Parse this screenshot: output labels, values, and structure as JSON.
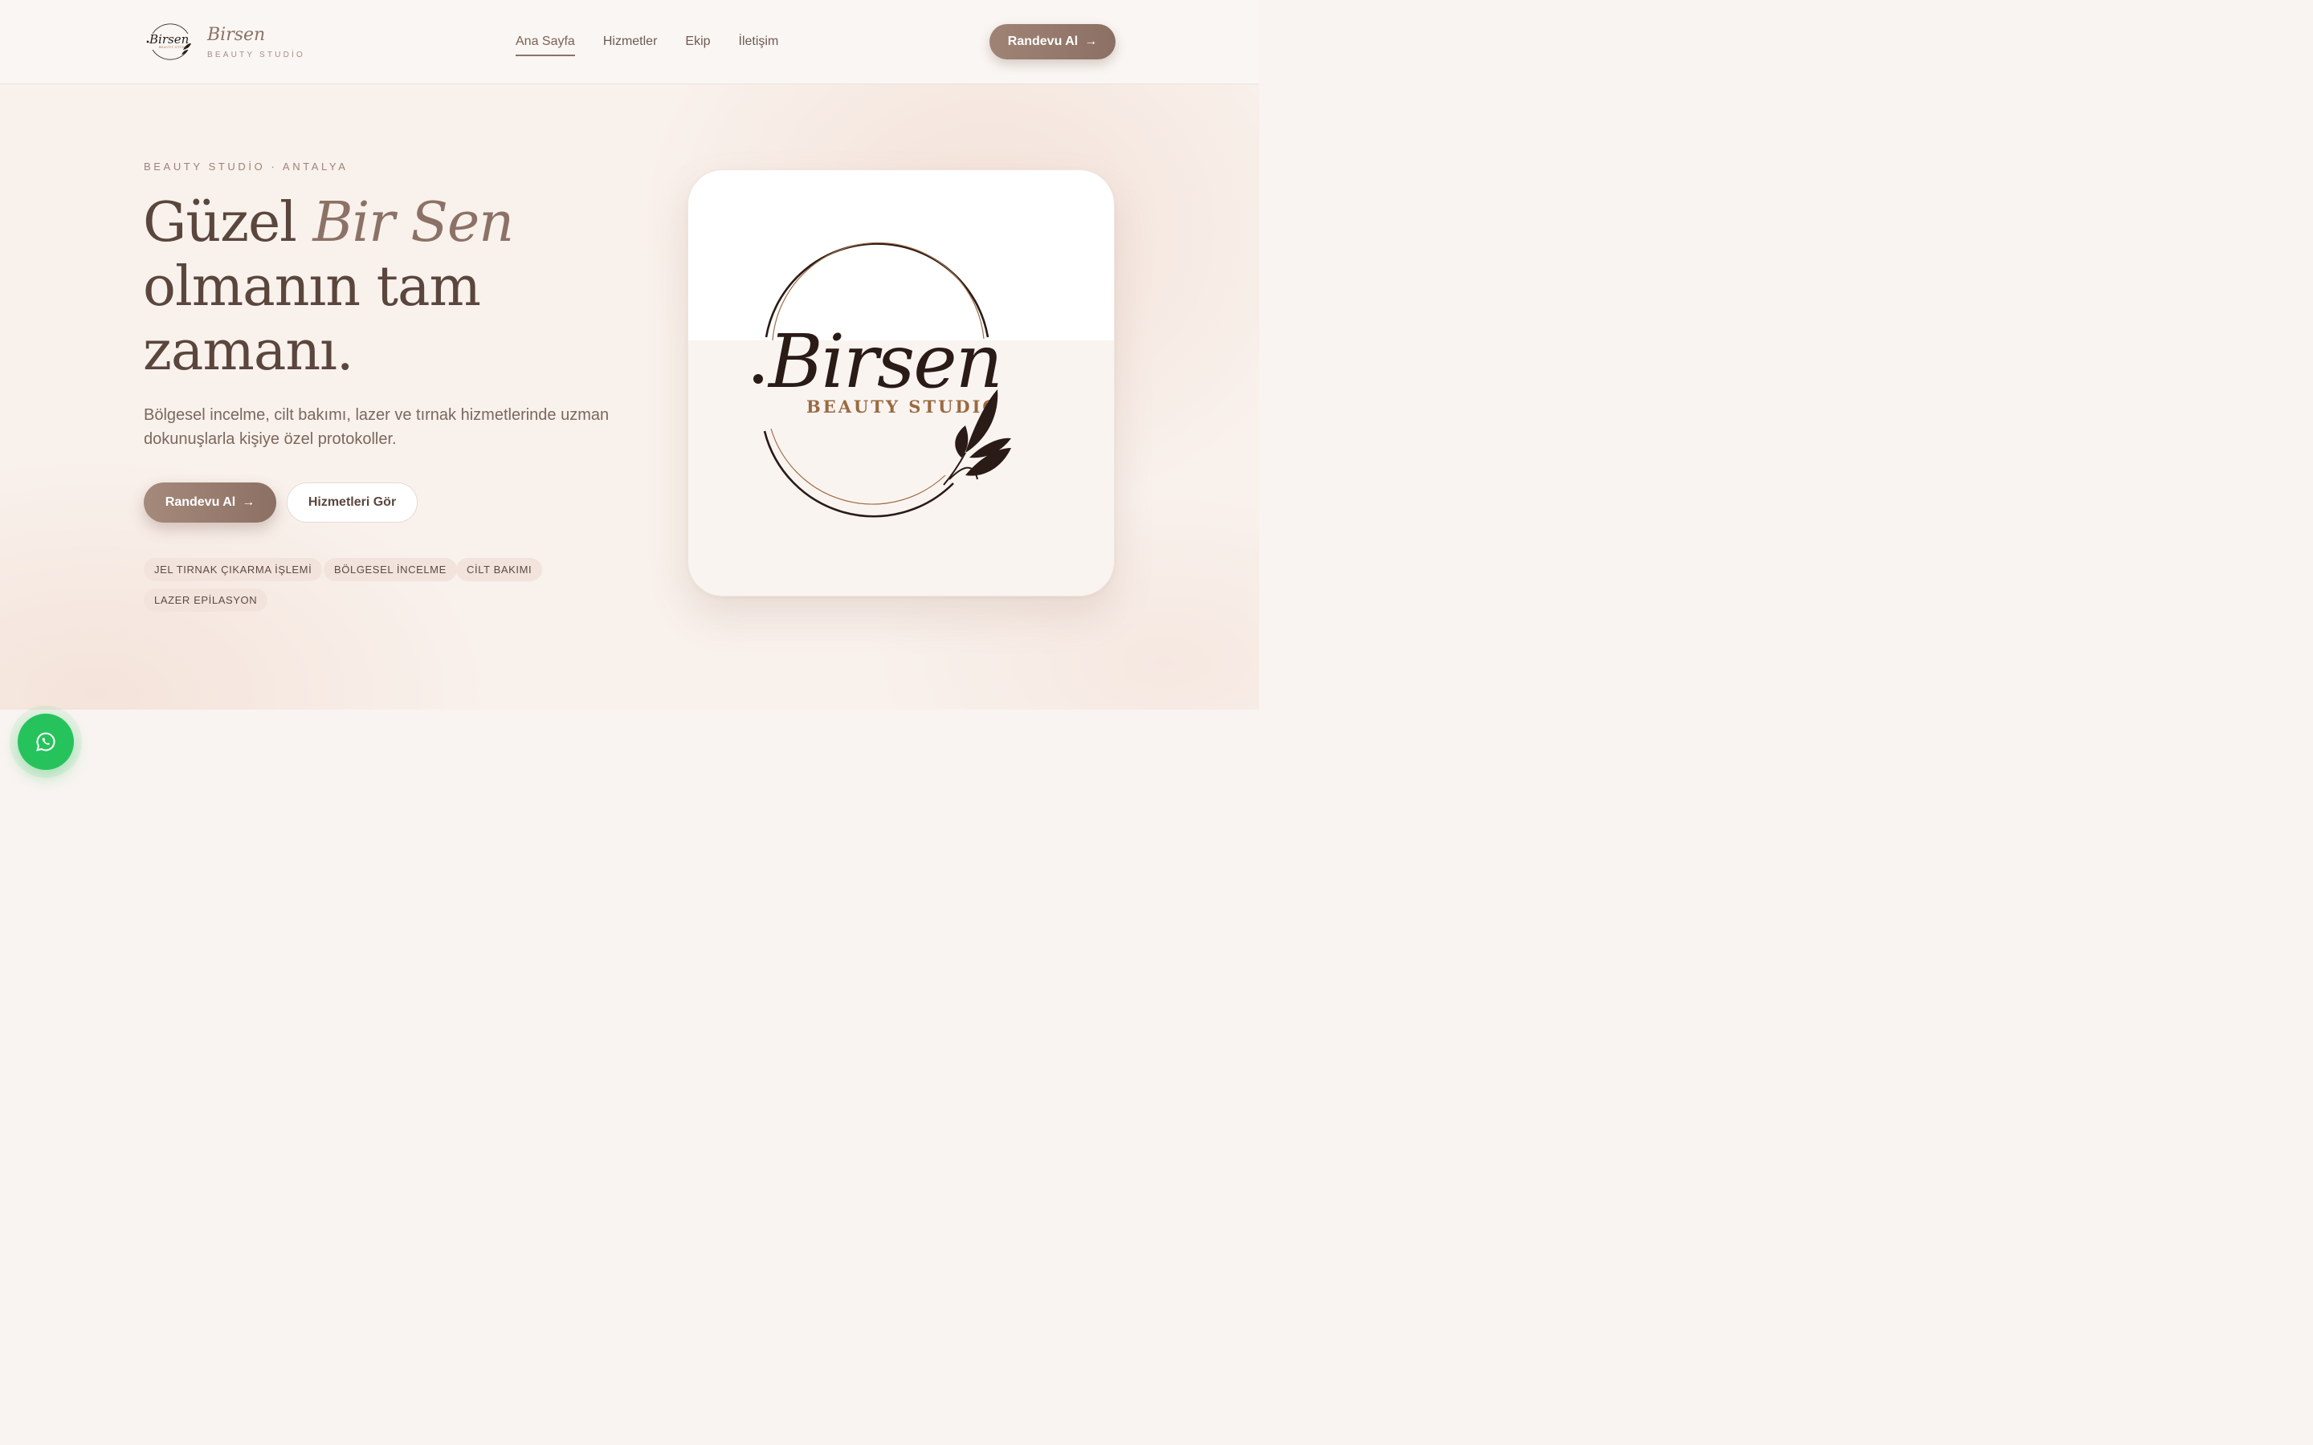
{
  "brand": {
    "name": "Birsen",
    "subtitle": "BEAUTY STUDİO",
    "logo_script": "Birsen",
    "logo_caption": "BEAUTY STUDIO"
  },
  "nav": {
    "items": [
      "Ana Sayfa",
      "Hizmetler",
      "Ekip",
      "İletişim"
    ],
    "active": "Ana Sayfa",
    "cta_label": "Randevu Al",
    "cta_arrow": "→"
  },
  "hero": {
    "eyebrow": "BEAUTY STUDİO · ANTALYA",
    "title_line1_plain": "Güzel ",
    "title_line1_accent": "Bir Sen",
    "title_line2": "olmanın tam",
    "title_line3": "zamanı.",
    "description_line1": "Bölgesel incelme, cilt bakımı, lazer ve tırnak hizmetlerinde uzman",
    "description_line2": "dokunuşlarla kişiye özel protokoller.",
    "primary_cta": "Randevu Al",
    "primary_cta_arrow": "→",
    "secondary_cta": "Hizmetleri Gör",
    "tags": [
      "JEL TIRNAK ÇIKARMA İŞLEMİ",
      "BÖLGESEL İNCELME",
      "CİLT BAKIMI",
      "LAZER EPİLASYON"
    ]
  },
  "logo_card": {
    "script": "Birsen",
    "caption": "BEAUTY STUDIO"
  },
  "floating": {
    "whatsapp_icon": "whatsapp-icon"
  },
  "colors": {
    "accent": "#8c7266",
    "primary_text": "#5a463d",
    "tag_bg": "#f2e4dd",
    "whatsapp": "#26c35c",
    "logo_gold": "#9a6a40"
  }
}
